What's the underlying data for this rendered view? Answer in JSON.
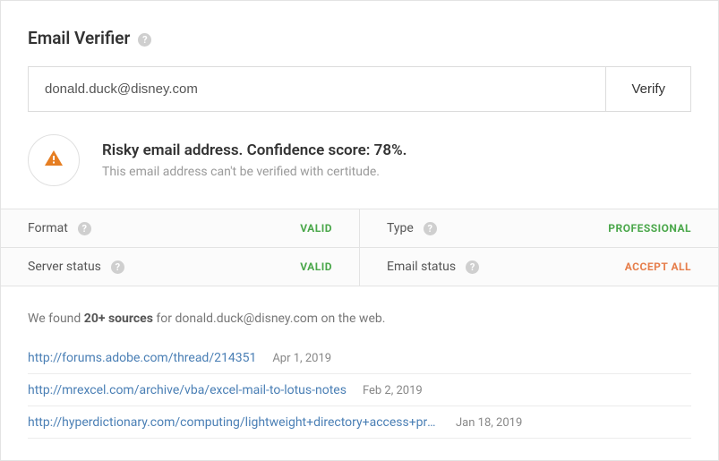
{
  "header": {
    "title": "Email Verifier"
  },
  "input": {
    "email_value": "donald.duck@disney.com",
    "verify_label": "Verify"
  },
  "result": {
    "heading": "Risky email address. Confidence score: 78%.",
    "subtext": "This email address can't be verified with certitude."
  },
  "attributes": {
    "format_label": "Format",
    "format_value": "VALID",
    "type_label": "Type",
    "type_value": "PROFESSIONAL",
    "server_label": "Server status",
    "server_value": "VALID",
    "email_status_label": "Email status",
    "email_status_value": "ACCEPT ALL"
  },
  "sources": {
    "intro_pre": "We found ",
    "intro_count": "20+ sources",
    "intro_post": " for donald.duck@disney.com on the web.",
    "list": [
      {
        "url": "http://forums.adobe.com/thread/214351",
        "date": "Apr 1, 2019"
      },
      {
        "url": "http://mrexcel.com/archive/vba/excel-mail-to-lotus-notes",
        "date": "Feb 2, 2019"
      },
      {
        "url": "http://hyperdictionary.com/computing/lightweight+directory+access+prot...",
        "date": "Jan 18, 2019"
      }
    ]
  }
}
